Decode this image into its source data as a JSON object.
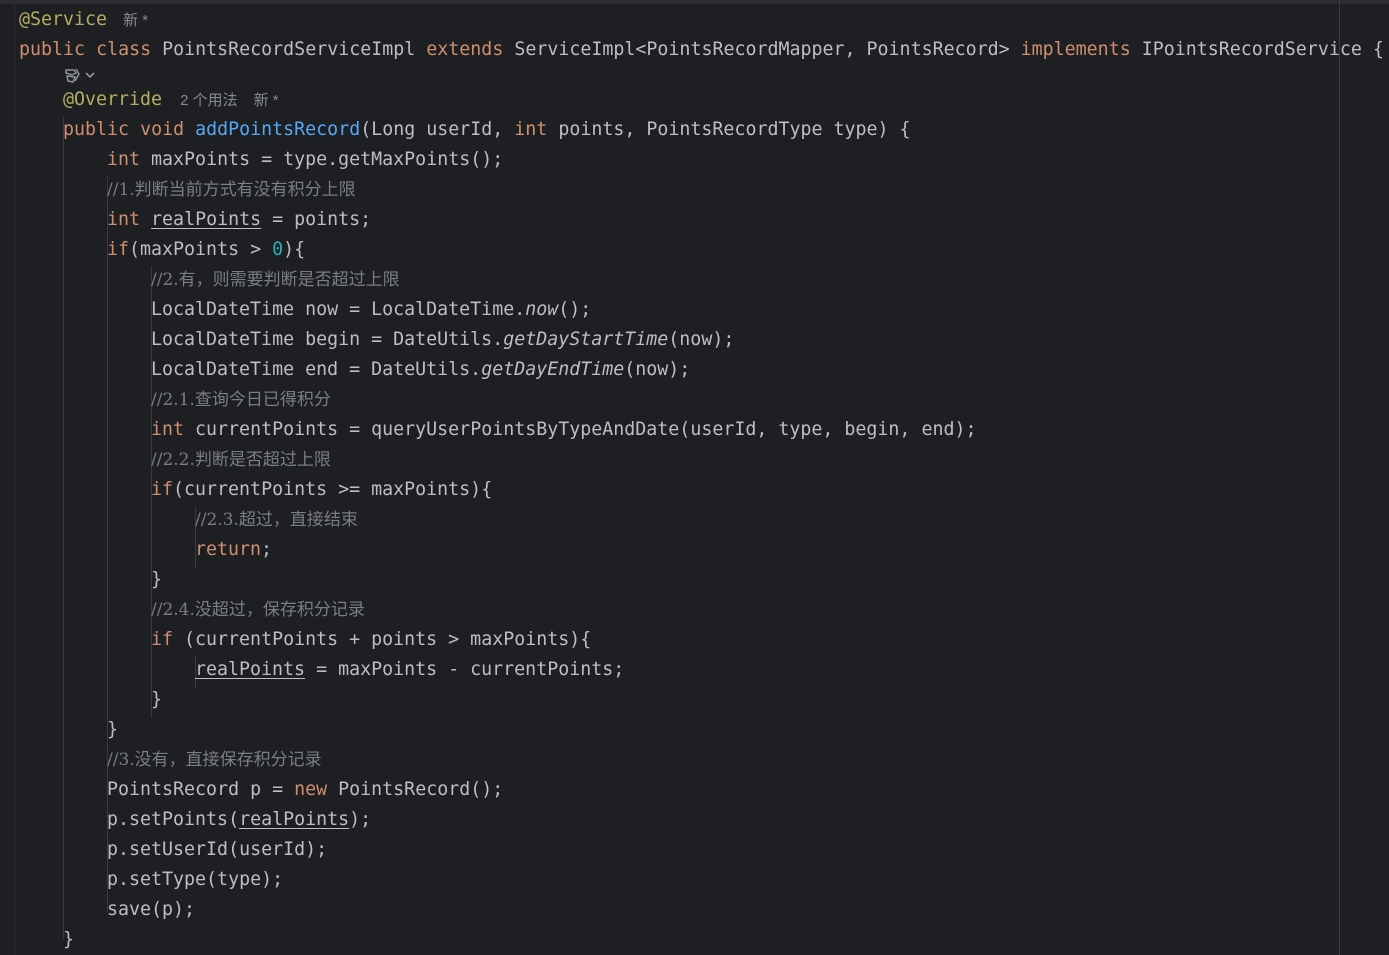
{
  "editor": {
    "line01": {
      "annotation": "@Service",
      "hint_new": "新 *"
    },
    "line02": {
      "kw_public": "public",
      "kw_class": "class",
      "class_name": "PointsRecordServiceImpl",
      "kw_extends": "extends",
      "super_type": "ServiceImpl<PointsRecordMapper, PointsRecord>",
      "kw_implements": "implements",
      "interface_name": "IPointsRecordService {"
    },
    "line03": {
      "icon": "ai-assistant-icon",
      "chevron": "chevron-down-icon"
    },
    "line04": {
      "annotation": "@Override",
      "hint_usages": "2 个用法",
      "hint_new": "新 *"
    },
    "line05": {
      "kw_public": "public",
      "kw_void": "void",
      "method_name": "addPointsRecord",
      "p1": "(Long userId, ",
      "kw_int": "int",
      "p2": " points, PointsRecordType type) {"
    },
    "line06": {
      "kw_int": "int",
      "code": " maxPoints = type.getMaxPoints();"
    },
    "line07": {
      "comment": "//1.判断当前方式有没有积分上限"
    },
    "line08": {
      "kw_int": "int",
      "var_real": "realPoints",
      "code": " = points;"
    },
    "line09": {
      "kw_if": "if",
      "code_a": "(maxPoints > ",
      "num_zero": "0",
      "code_b": "){"
    },
    "line10": {
      "comment": "//2.有，则需要判断是否超过上限"
    },
    "line11": {
      "code_a": "LocalDateTime now = LocalDateTime.",
      "static_call": "now",
      "code_b": "();"
    },
    "line12": {
      "code_a": "LocalDateTime begin = DateUtils.",
      "static_call": "getDayStartTime",
      "code_b": "(now);"
    },
    "line13": {
      "code_a": "LocalDateTime end = DateUtils.",
      "static_call": "getDayEndTime",
      "code_b": "(now);"
    },
    "line14": {
      "comment": "//2.1.查询今日已得积分"
    },
    "line15": {
      "kw_int": "int",
      "code": " currentPoints = queryUserPointsByTypeAndDate(userId, type, begin, end);"
    },
    "line16": {
      "comment": "//2.2.判断是否超过上限"
    },
    "line17": {
      "kw_if": "if",
      "code": "(currentPoints >= maxPoints){"
    },
    "line18": {
      "comment": "//2.3.超过，直接结束"
    },
    "line19": {
      "kw_return": "return",
      "code": ";"
    },
    "line20": {
      "code": "}"
    },
    "line21": {
      "comment": "//2.4.没超过，保存积分记录"
    },
    "line22": {
      "kw_if": "if",
      "code": " (currentPoints + points > maxPoints){"
    },
    "line23": {
      "var_real": "realPoints",
      "code": " = maxPoints - currentPoints;"
    },
    "line24": {
      "code": "}"
    },
    "line25": {
      "code": "}"
    },
    "line26": {
      "comment": "//3.没有，直接保存积分记录"
    },
    "line27": {
      "code_a": "PointsRecord p = ",
      "kw_new": "new",
      "code_b": " PointsRecord();"
    },
    "line28": {
      "code_a": "p.setPoints(",
      "var_real": "realPoints",
      "code_b": ");"
    },
    "line29": {
      "code": "p.setUserId(userId);"
    },
    "line30": {
      "code": "p.setType(type);"
    },
    "line31": {
      "code": "save(p);"
    },
    "line32": {
      "code": "}"
    }
  },
  "colors": {
    "background": "#1e1f22",
    "text": "#bcbec4",
    "keyword": "#cf8e6d",
    "annotation": "#b3ae60",
    "method_decl": "#56a8f5",
    "number": "#2aacb8",
    "comment": "#7a7e85"
  }
}
